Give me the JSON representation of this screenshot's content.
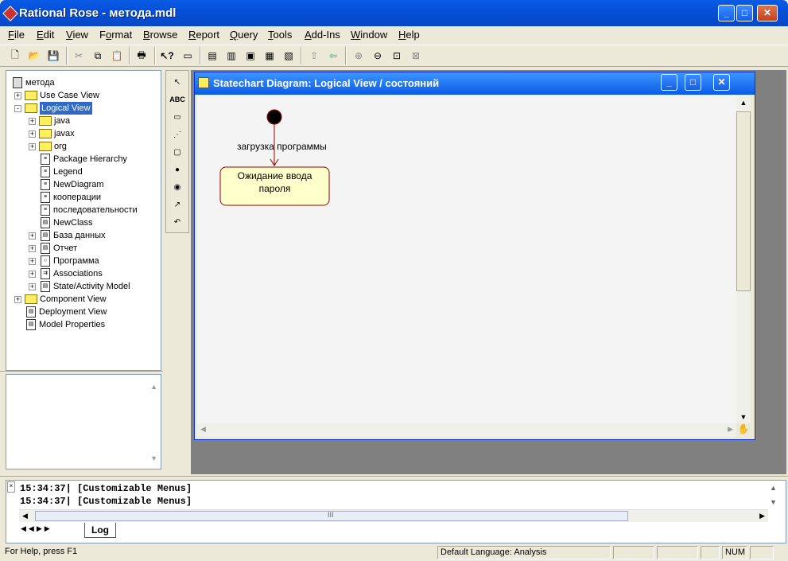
{
  "window": {
    "title": "Rational Rose - метода.mdl",
    "minimize": "0",
    "maximize": "1",
    "close": "r"
  },
  "menu": [
    "File",
    "Edit",
    "View",
    "Format",
    "Browse",
    "Report",
    "Query",
    "Tools",
    "Add-Ins",
    "Window",
    "Help"
  ],
  "toolbar": [
    "new",
    "open",
    "save",
    "cut",
    "copy",
    "paste",
    "print",
    "context-help",
    "view-doc",
    "browse-class",
    "browse-interaction",
    "browse-component",
    "browse-deployment",
    "browse-parent",
    "browse-previous",
    "zoom-in",
    "zoom-out",
    "fit-in-window",
    "undo-fit"
  ],
  "tree": {
    "root": "метода",
    "items": [
      {
        "label": "Use Case View",
        "level": 1,
        "exp": "+",
        "icon": "folder"
      },
      {
        "label": "Logical View",
        "level": 1,
        "exp": "-",
        "icon": "folder",
        "selected": true
      },
      {
        "label": "java",
        "level": 2,
        "exp": "+",
        "icon": "folder"
      },
      {
        "label": "javax",
        "level": 2,
        "exp": "+",
        "icon": "folder"
      },
      {
        "label": "org",
        "level": 2,
        "exp": "+",
        "icon": "folder"
      },
      {
        "label": "Package Hierarchy",
        "level": 2,
        "exp": "",
        "icon": "diagram"
      },
      {
        "label": "Legend",
        "level": 2,
        "exp": "",
        "icon": "diagram"
      },
      {
        "label": "NewDiagram",
        "level": 2,
        "exp": "",
        "icon": "diagram"
      },
      {
        "label": "кооперации",
        "level": 2,
        "exp": "",
        "icon": "diagram"
      },
      {
        "label": "последовательности",
        "level": 2,
        "exp": "",
        "icon": "diagram"
      },
      {
        "label": "NewClass",
        "level": 2,
        "exp": "",
        "icon": "class"
      },
      {
        "label": "База данных",
        "level": 2,
        "exp": "+",
        "icon": "class"
      },
      {
        "label": "Отчет",
        "level": 2,
        "exp": "+",
        "icon": "class"
      },
      {
        "label": "Программа",
        "level": 2,
        "exp": "+",
        "icon": "interface"
      },
      {
        "label": "Associations",
        "level": 2,
        "exp": "+",
        "icon": "assoc"
      },
      {
        "label": "State/Activity Model",
        "level": 2,
        "exp": "+",
        "icon": "state"
      },
      {
        "label": "Component View",
        "level": 1,
        "exp": "+",
        "icon": "folder"
      },
      {
        "label": "Deployment View",
        "level": 1,
        "exp": "",
        "icon": "deploy"
      },
      {
        "label": "Model Properties",
        "level": 1,
        "exp": "",
        "icon": "props"
      }
    ]
  },
  "palette": [
    "selection-tool",
    "ABC",
    "note",
    "anchor-note",
    "state",
    "start-state",
    "end-state",
    "state-transition",
    "transition-to-self"
  ],
  "diagram": {
    "title": "Statechart Diagram: Logical View / состояний",
    "transition_label": "загрузка программы",
    "state_line1": "Ожидание ввода",
    "state_line2": "пароля"
  },
  "log": {
    "lines": [
      "15:34:37|  [Customizable Menus]",
      "15:34:37|  [Customizable Menus]"
    ],
    "tab": "Log",
    "scroll_label": "III"
  },
  "status": {
    "help": "For Help, press F1",
    "language": "Default Language: Analysis",
    "num": "NUM"
  }
}
